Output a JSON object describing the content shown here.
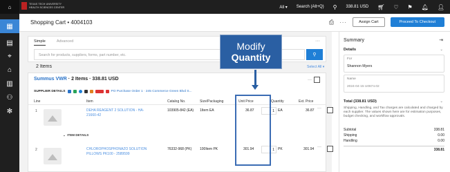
{
  "topbar": {
    "logo_line1": "TEXAS TECH UNIVERSITY",
    "logo_line2": "HEALTH SCIENCES CENTER",
    "scope": "All ▾",
    "search_label": "Search (Alt+Q)",
    "cart_total": "338.81 USD"
  },
  "header": {
    "title": "Shopping Cart  •  4004103",
    "assign_cart": "Assign Cart",
    "proceed": "Proceed To Checkout"
  },
  "search_panel": {
    "tab_simple": "Simple",
    "tab_advanced": "Advanced",
    "placeholder": "Search for products, suppliers, forms, part number, etc."
  },
  "items": {
    "count_label": "2 Items",
    "select_all": "Select All ▾"
  },
  "supplier": {
    "name": "Summus VWR",
    "summary": " · 2 Items · 338.81 USD",
    "details_label": "SUPPLIER DETAILS",
    "po_link": "PO Purchase Order 1 · 245 Commerce Green Blvd S..."
  },
  "columns": {
    "line": "Line",
    "item": "Item",
    "catalog": "Catalog No.",
    "size": "Size/Packaging",
    "unit_price": "Unit Price",
    "quantity": "Quantity",
    "ext_price": "Ext. Price"
  },
  "rows": [
    {
      "line": "1",
      "name": "DEHA REAGENT 2 SOLUTION - HA-21660-42",
      "catalog": "103905-842 (EA)",
      "size": "1Item EA",
      "unit_price": "36.87",
      "qty": "1",
      "uom": "EA",
      "ext_price": "36.87"
    },
    {
      "line": "2",
      "name": "CHLOROPHOSPHONAZO SOLUTION PILLOWS PK100 - 2589599",
      "catalog": "76332-968 (PK)",
      "size": "100Item PK",
      "unit_price": "301.94",
      "qty": "1",
      "uom": "PK",
      "ext_price": "301.94"
    }
  ],
  "item_details_label": "ITEM DETAILS",
  "summary": {
    "title": "Summary",
    "details_heading": "Details",
    "for_label": "For",
    "for_value": "Shannon Myers",
    "name_label": "Name",
    "name_value": "2024-04-15 U0674.02",
    "total_heading": "Total (338.81 USD)",
    "note": "Shipping, Handling, and Tax charges are calculated and charged by each supplier. The values shown here are for estimation purposes, budget checking, and workflow approvals.",
    "subtotal_label": "Subtotal",
    "subtotal_value": "338.81",
    "shipping_label": "Shipping",
    "shipping_value": "0.00",
    "handling_label": "Handling",
    "handling_value": "0.00",
    "total_value": "338.81"
  },
  "callout": {
    "line1": "Modify",
    "line2": "Quantity"
  },
  "colors": {
    "accent": "#1f7fd6",
    "callout": "#2a5fa3",
    "rail": "#1f1f1f"
  }
}
